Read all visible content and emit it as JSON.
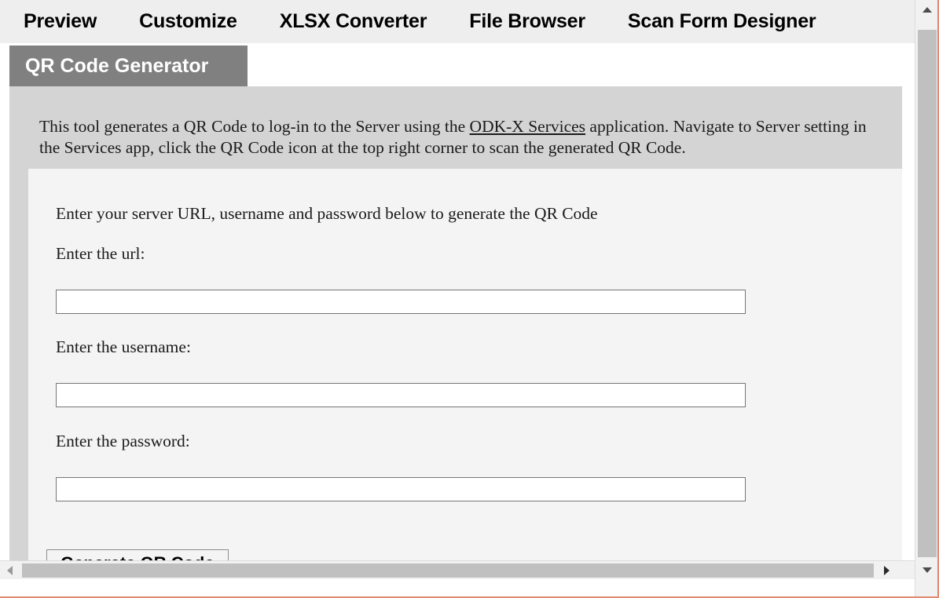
{
  "nav": {
    "items": [
      {
        "label": "Preview"
      },
      {
        "label": "Customize"
      },
      {
        "label": "XLSX Converter"
      },
      {
        "label": "File Browser"
      },
      {
        "label": "Scan Form Designer"
      }
    ]
  },
  "tabs": {
    "active": {
      "label": "QR Code Generator"
    }
  },
  "description": {
    "part1": "This tool generates a QR Code to log-in to the Server using the ",
    "link": "ODK-X Services",
    "part2": " application. Navigate to Server setting in the Services app, click the QR Code icon at the top right corner to scan the generated QR Code."
  },
  "form": {
    "intro": "Enter your server URL, username and password below to generate the QR Code",
    "url": {
      "label": "Enter the url:",
      "value": "",
      "placeholder": ""
    },
    "username": {
      "label": "Enter the username:",
      "value": "",
      "placeholder": ""
    },
    "password": {
      "label": "Enter the password:",
      "value": "",
      "placeholder": ""
    },
    "submit_label": "Generate QR Code"
  },
  "colors": {
    "nav_bg": "#eeeeee",
    "active_tab_bg": "#808080",
    "active_tab_text": "#ffffff",
    "content_bg": "#d4d4d4",
    "panel_bg": "#f4f4f4",
    "text": "#1a1a1a",
    "input_border": "#767676",
    "scrollbar_thumb": "#c0c0c0"
  },
  "scrollbars": {
    "vertical": {
      "up_icon": "triangle-up-icon",
      "down_icon": "triangle-down-icon"
    },
    "horizontal": {
      "left_icon": "triangle-left-icon",
      "right_icon": "triangle-right-icon"
    }
  }
}
